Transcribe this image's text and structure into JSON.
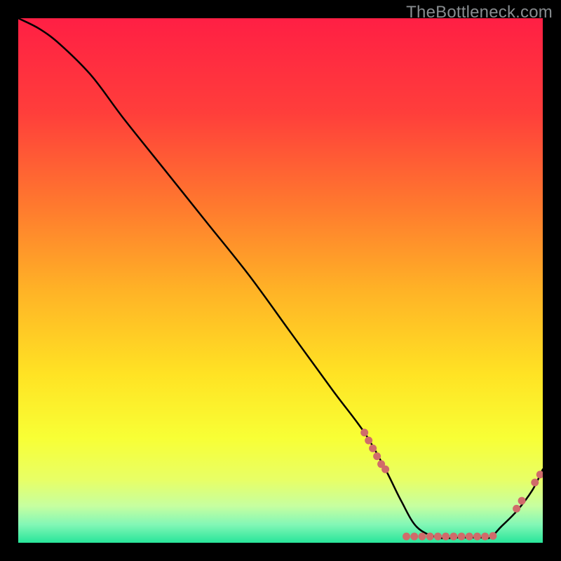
{
  "watermark": "TheBottleneck.com",
  "chart_data": {
    "type": "line",
    "title": "",
    "xlabel": "",
    "ylabel": "",
    "xlim": [
      0,
      100
    ],
    "ylim": [
      0,
      100
    ],
    "grid": false,
    "curve_note": "Bottleneck curve: high at x=0, descends roughly linearly, flat near-zero over ~72–90, rises toward x=100.",
    "x": [
      0,
      4,
      8,
      14,
      20,
      28,
      36,
      44,
      52,
      60,
      66,
      70,
      73,
      76,
      80,
      84,
      88,
      90,
      92,
      95,
      98,
      100
    ],
    "y": [
      100,
      98,
      95,
      89,
      81,
      71,
      61,
      51,
      40,
      29,
      21,
      14,
      8,
      3,
      1,
      1,
      1,
      1,
      3,
      6,
      10,
      14
    ],
    "markers": [
      {
        "x": 66.0,
        "y": 21.0
      },
      {
        "x": 66.8,
        "y": 19.5
      },
      {
        "x": 67.6,
        "y": 18.0
      },
      {
        "x": 68.4,
        "y": 16.5
      },
      {
        "x": 69.2,
        "y": 15.0
      },
      {
        "x": 70.0,
        "y": 14.0
      },
      {
        "x": 74.0,
        "y": 1.2
      },
      {
        "x": 75.5,
        "y": 1.2
      },
      {
        "x": 77.0,
        "y": 1.2
      },
      {
        "x": 78.5,
        "y": 1.2
      },
      {
        "x": 80.0,
        "y": 1.2
      },
      {
        "x": 81.5,
        "y": 1.2
      },
      {
        "x": 83.0,
        "y": 1.2
      },
      {
        "x": 84.5,
        "y": 1.2
      },
      {
        "x": 86.0,
        "y": 1.2
      },
      {
        "x": 87.5,
        "y": 1.2
      },
      {
        "x": 89.0,
        "y": 1.2
      },
      {
        "x": 90.5,
        "y": 1.3
      },
      {
        "x": 95.0,
        "y": 6.5
      },
      {
        "x": 96.0,
        "y": 8.0
      },
      {
        "x": 98.5,
        "y": 11.5
      },
      {
        "x": 99.5,
        "y": 13.0
      }
    ],
    "marker_color": "#d06b6a",
    "gradient_stops": [
      {
        "offset": 0.0,
        "color": "#ff1f44"
      },
      {
        "offset": 0.18,
        "color": "#ff3e3b"
      },
      {
        "offset": 0.36,
        "color": "#ff7a2e"
      },
      {
        "offset": 0.52,
        "color": "#ffb326"
      },
      {
        "offset": 0.68,
        "color": "#ffe324"
      },
      {
        "offset": 0.8,
        "color": "#f8ff35"
      },
      {
        "offset": 0.88,
        "color": "#e8ff66"
      },
      {
        "offset": 0.93,
        "color": "#c6ffa0"
      },
      {
        "offset": 0.965,
        "color": "#83f7b6"
      },
      {
        "offset": 1.0,
        "color": "#28e59a"
      }
    ]
  }
}
